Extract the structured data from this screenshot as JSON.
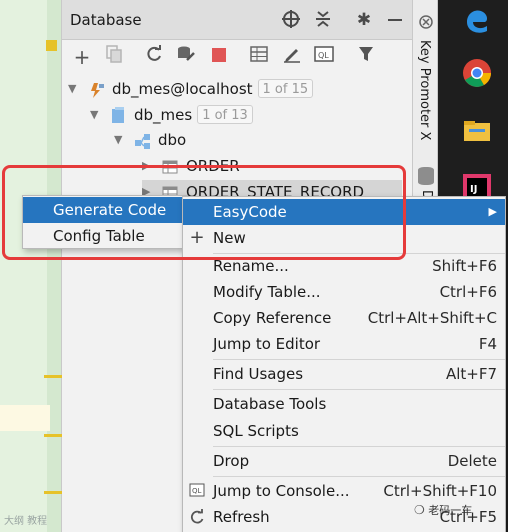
{
  "panel": {
    "title": "Database",
    "title_icons": [
      "crosshair-icon",
      "collapse-icon",
      "gear-icon",
      "minimize-icon"
    ],
    "toolbar_icons": [
      "add-icon",
      "copy-icon",
      "refresh-icon",
      "schema-icon",
      "stop-icon",
      "table-icon",
      "edit-icon",
      "sql-console-icon",
      "filter-icon"
    ]
  },
  "tree": {
    "datasource": {
      "label": "db_mes@localhost",
      "badge": "1 of 15"
    },
    "database": {
      "label": "db_mes",
      "badge": "1 of 13"
    },
    "schema": {
      "label": "dbo"
    },
    "tables": [
      {
        "label": "ORDER"
      },
      {
        "label": "ORDER_STATE_RECORD"
      }
    ]
  },
  "submenu": {
    "items": [
      {
        "label": "Generate Code",
        "selected": true
      },
      {
        "label": "Config Table",
        "selected": false
      }
    ]
  },
  "context_menu": {
    "items": [
      {
        "label": "EasyCode",
        "shortcut": "",
        "icon": "",
        "selected": true
      },
      {
        "label": "New",
        "shortcut": "",
        "icon": "plus-icon",
        "selected": false
      },
      {
        "label": "Rename...",
        "shortcut": "Shift+F6",
        "icon": "",
        "selected": false
      },
      {
        "label": "Modify Table...",
        "shortcut": "Ctrl+F6",
        "icon": "",
        "selected": false
      },
      {
        "label": "Copy Reference",
        "shortcut": "Ctrl+Alt+Shift+C",
        "icon": "",
        "selected": false
      },
      {
        "label": "Jump to Editor",
        "shortcut": "F4",
        "icon": "",
        "selected": false
      },
      {
        "label": "Find Usages",
        "shortcut": "Alt+F7",
        "icon": "",
        "selected": false
      },
      {
        "label": "Database Tools",
        "shortcut": "",
        "icon": "",
        "selected": false
      },
      {
        "label": "SQL Scripts",
        "shortcut": "",
        "icon": "",
        "selected": false
      },
      {
        "label": "Drop",
        "shortcut": "Delete",
        "icon": "",
        "selected": false
      },
      {
        "label": "Jump to Console...",
        "shortcut": "Ctrl+Shift+F10",
        "icon": "console-icon",
        "selected": false
      },
      {
        "label": "Refresh",
        "shortcut": "Ctrl+F5",
        "icon": "refresh-icon",
        "selected": false
      }
    ]
  },
  "side_strip": {
    "key_promoter": "Key Promoter X",
    "database_tab": "D"
  },
  "watermarks": {
    "left": "大纲 教程",
    "right": "老码一车"
  },
  "colors": {
    "selection": "#2675bf",
    "highlight_box": "#e53b3b",
    "editor_bg": "#e4f2df"
  }
}
